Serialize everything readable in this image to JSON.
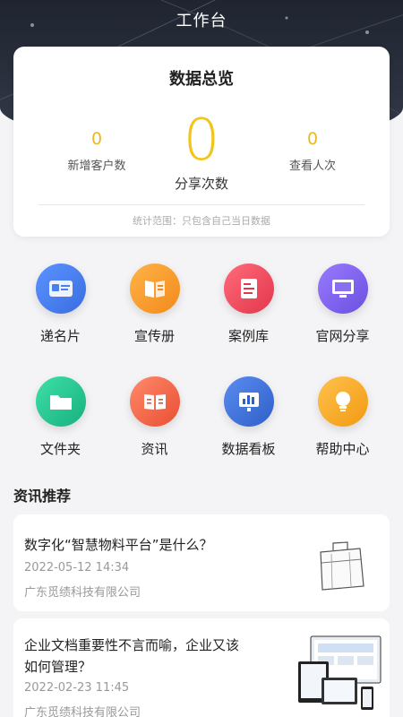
{
  "header": {
    "title": "工作台"
  },
  "stats": {
    "title": "数据总览",
    "new_customers": {
      "value": "0",
      "label": "新增客户数"
    },
    "shares": {
      "value": "0",
      "label": "分享次数"
    },
    "views": {
      "value": "0",
      "label": "查看人次"
    },
    "note": "统计范围：只包含自己当日数据"
  },
  "grid": [
    {
      "label": "递名片",
      "icon": "business-card-icon",
      "color": "#4a7ff0"
    },
    {
      "label": "宣传册",
      "icon": "brochure-icon",
      "color": "#f59a2b"
    },
    {
      "label": "案例库",
      "icon": "case-library-icon",
      "color": "#f0475a"
    },
    {
      "label": "官网分享",
      "icon": "website-share-icon",
      "color": "#7f62ee"
    },
    {
      "label": "文件夹",
      "icon": "folder-icon",
      "color": "#27c48f"
    },
    {
      "label": "资讯",
      "icon": "news-book-icon",
      "color": "#f2664a"
    },
    {
      "label": "数据看板",
      "icon": "data-board-icon",
      "color": "#3d6fd8"
    },
    {
      "label": "帮助中心",
      "icon": "lightbulb-icon",
      "color": "#f5a623"
    }
  ],
  "news_section": {
    "title": "资讯推荐"
  },
  "news": [
    {
      "title": "数字化“智慧物料平台”是什么？",
      "date": "2022-05-12 14:34",
      "source": "广东觅绩科技有限公司",
      "thumb": "briefcase-sketch"
    },
    {
      "title_line1": "企业文档重要性不言而喻，企业又该",
      "title_line2": "如何管理？",
      "date": "2022-02-23 11:45",
      "source": "广东觅绩科技有限公司",
      "thumb": "devices-mockup"
    }
  ]
}
